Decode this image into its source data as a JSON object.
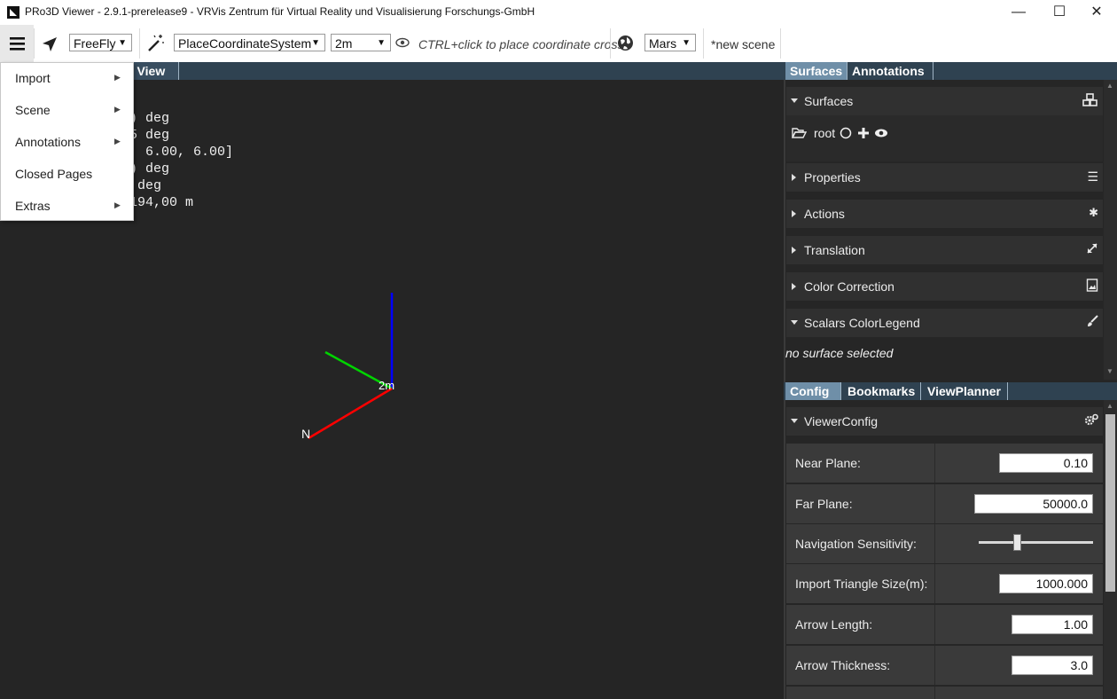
{
  "window": {
    "title": "PRo3D Viewer - 2.9.1-prerelease9 - VRVis Zentrum für Virtual Reality und Visualisierung Forschungs-GmbH",
    "minimize": "—",
    "maximize": "☐",
    "close": "✕"
  },
  "toolbar": {
    "hamburger_icon": "☰",
    "nav_icon": "➤",
    "nav_mode": "FreeFly",
    "wand_icon": "⚡",
    "interaction_mode": "PlaceCoordinateSystem",
    "size": "2m",
    "eye_icon": "👁",
    "hint": "CTRL+click to place coordinate cross",
    "globe_icon": "◉",
    "planet": "Mars",
    "scene_name": "*new scene"
  },
  "menu": {
    "items": [
      {
        "label": "Import",
        "submenu": true
      },
      {
        "label": "Scene",
        "submenu": true
      },
      {
        "label": "Annotations",
        "submenu": true
      },
      {
        "label": "Closed Pages",
        "submenu": false
      },
      {
        "label": "Extras",
        "submenu": true
      }
    ]
  },
  "render_view": {
    "tab_label": "t View",
    "overlay_lines": [
      ") deg",
      "5 deg",
      "  6.00, 6.00]",
      ") deg",
      " deg",
      "194,00 m"
    ],
    "axis_label": "2m",
    "north_label": "N",
    "colors": {
      "x_axis": "#ff0000",
      "y_axis": "#00e000",
      "z_axis": "#0000ff"
    }
  },
  "top_panel": {
    "tabs": [
      {
        "label": "Surfaces",
        "active": true
      },
      {
        "label": "Annotations",
        "active": false
      }
    ],
    "surfaces_header": "Surfaces",
    "tree_root": "root",
    "sections": [
      "Properties",
      "Actions",
      "Translation",
      "Color Correction"
    ],
    "scalars_header": "Scalars ColorLegend",
    "no_selection": "no surface selected"
  },
  "bottom_panel": {
    "tabs": [
      {
        "label": "Config",
        "active": true
      },
      {
        "label": "Bookmarks",
        "active": false
      },
      {
        "label": "ViewPlanner",
        "active": false
      }
    ],
    "viewer_config_header": "ViewerConfig",
    "rows": {
      "near_plane": {
        "label": "Near Plane:",
        "value": "0.10"
      },
      "far_plane": {
        "label": "Far Plane:",
        "value": "50000.0"
      },
      "nav_sensitivity": {
        "label": "Navigation Sensitivity:",
        "level": 0.34
      },
      "import_triangle": {
        "label": "Import Triangle Size(m):",
        "value": "1000.000"
      },
      "arrow_length": {
        "label": "Arrow Length:",
        "value": "1.00"
      },
      "arrow_thickness": {
        "label": "Arrow Thickness:",
        "value": "3.0"
      }
    }
  }
}
